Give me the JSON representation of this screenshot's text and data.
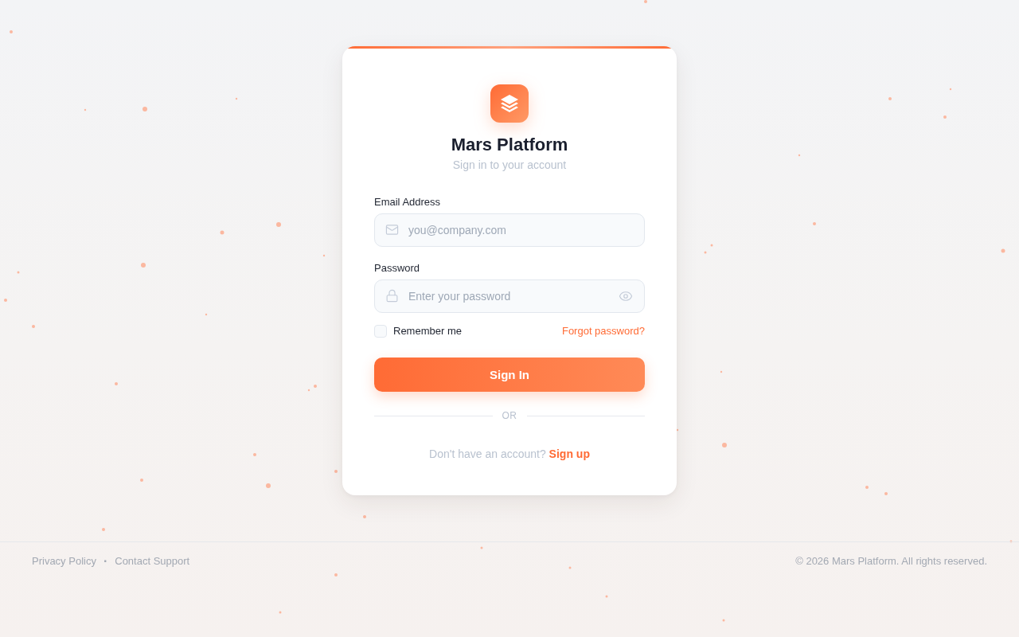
{
  "brand": {
    "title": "Mars Platform",
    "subtitle": "Sign in to your account"
  },
  "form": {
    "fields": [
      {
        "kind": "email",
        "label": "Email Address",
        "placeholder": "you@company.com"
      },
      {
        "kind": "password",
        "label": "Password",
        "placeholder": "Enter your password"
      }
    ],
    "remember": {
      "label": "Remember me",
      "checked": false
    },
    "forgot_link": "Forgot password?",
    "submit": "Sign In",
    "divider": "OR",
    "signup": {
      "prompt": "Don't have an account?",
      "link": "Sign up"
    }
  },
  "footer": {
    "links": [
      "Privacy Policy",
      "Contact Support"
    ],
    "separator": "·",
    "copyright": "© 2026 Mars Platform. All rights reserved."
  }
}
